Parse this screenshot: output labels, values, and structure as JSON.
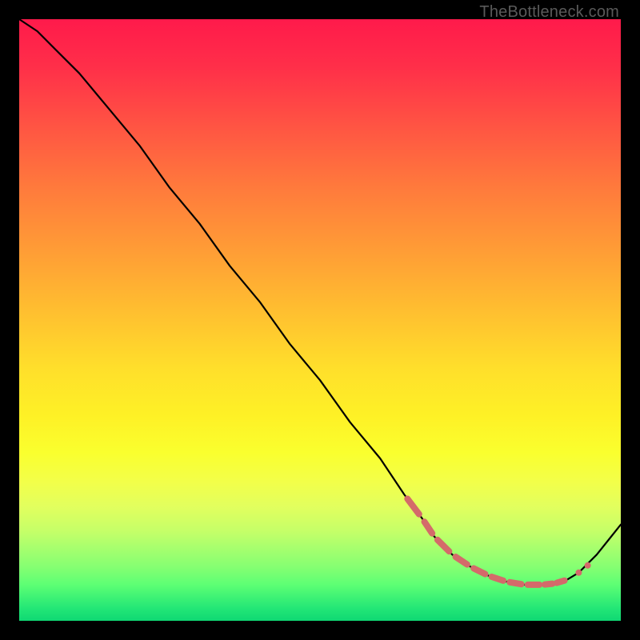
{
  "attribution": "TheBottleneck.com",
  "chart_data": {
    "type": "line",
    "title": "",
    "xlabel": "",
    "ylabel": "",
    "xlim": [
      0,
      100
    ],
    "ylim": [
      0,
      100
    ],
    "series": [
      {
        "name": "curve",
        "x": [
          0,
          3,
          6,
          10,
          15,
          20,
          25,
          30,
          35,
          40,
          45,
          50,
          55,
          60,
          64,
          67,
          69,
          72,
          75,
          78,
          81,
          84,
          87,
          89,
          91,
          93,
          96,
          100
        ],
        "y": [
          100,
          98,
          95,
          91,
          85,
          79,
          72,
          66,
          59,
          53,
          46,
          40,
          33,
          27,
          21,
          17,
          14,
          11,
          9,
          7.5,
          6.5,
          6,
          6,
          6.2,
          6.8,
          8,
          11,
          16
        ]
      }
    ],
    "highlight_band": {
      "name": "optimal-range",
      "x": [
        64,
        67,
        69,
        72,
        75,
        78,
        81,
        84,
        87,
        89,
        91
      ],
      "y": [
        21,
        17,
        14,
        11,
        9,
        7.5,
        6.5,
        6,
        6,
        6.2,
        6.8
      ],
      "style": "dashed"
    },
    "background_gradient": {
      "top_color": "#ff1a4b",
      "mid_color": "#ffe02b",
      "bottom_color": "#0fd873"
    }
  }
}
